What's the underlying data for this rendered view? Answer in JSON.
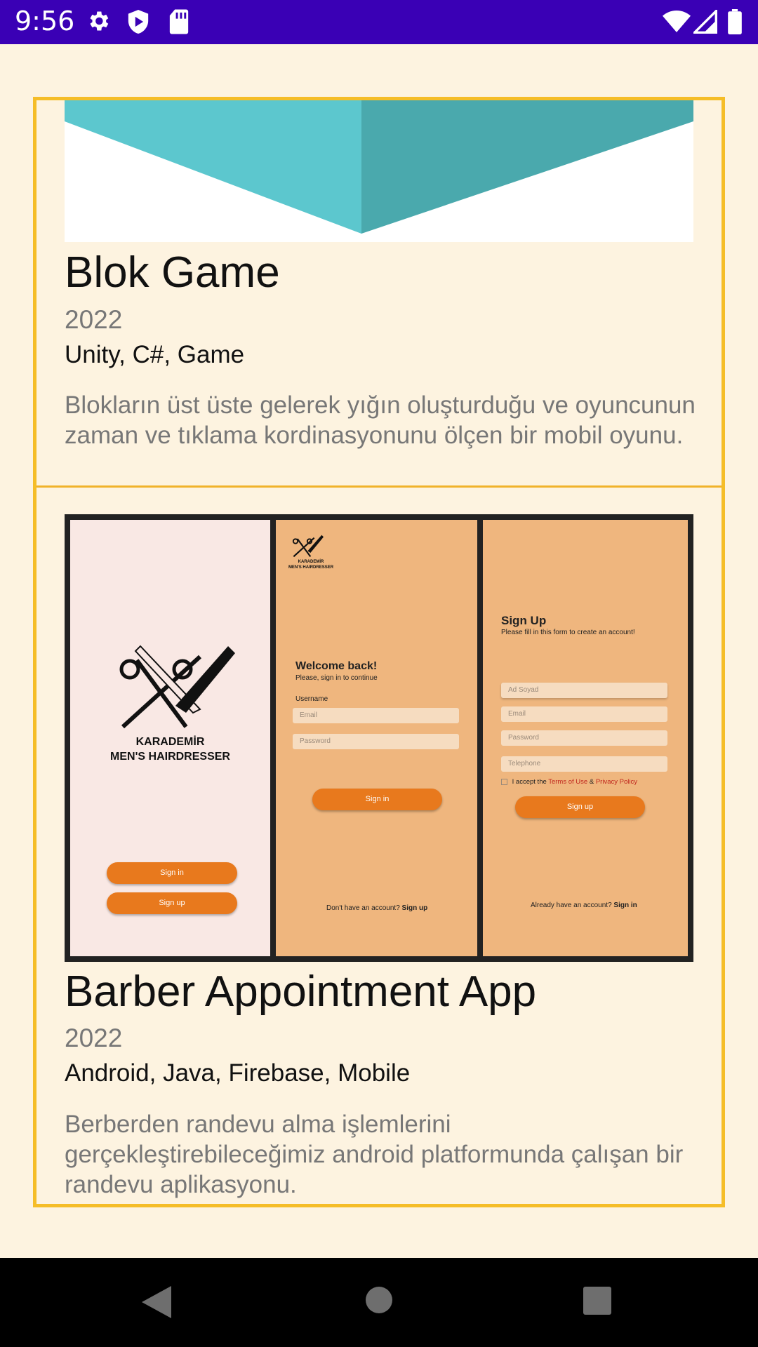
{
  "status_bar": {
    "time": "9:56",
    "icons": [
      "gear-icon",
      "play-shield-icon",
      "sd-card-icon",
      "wifi-icon",
      "signal-icon",
      "battery-icon"
    ]
  },
  "colors": {
    "status_bar": "#3a00b5",
    "background": "#fdf3e0",
    "card_border": "#f5bd28",
    "accent_orange": "#e8791d"
  },
  "projects": [
    {
      "title": "Blok Game",
      "year": "2022",
      "tags": "Unity, C#, Game",
      "description": "Blokların üst üste gelerek yığın oluşturduğu ve oyuncunun zaman ve tıklama kordinasyonunu ölçen bir mobil oyunu."
    },
    {
      "title": "Barber Appointment App",
      "year": "2022",
      "tags": "Android, Java, Firebase, Mobile",
      "description": "Berberden randevu alma işlemlerini gerçekleştirebileceğimiz android platformunda çalışan bir randevu aplikasyonu.",
      "screens": {
        "brand_line1": "KARADEMİR",
        "brand_line2": "MEN'S HAIRDRESSER",
        "sign_in": "Sign in",
        "sign_up": "Sign up",
        "welcome": "Welcome back!",
        "welcome_sub": "Please, sign in to continue",
        "username_label": "Username",
        "email_placeholder": "Email",
        "password_placeholder": "Password",
        "no_account": "Don't have an account?",
        "signup_title": "Sign Up",
        "signup_sub": "Please fill in this form to create an account!",
        "name_placeholder": "Ad Soyad",
        "telephone_placeholder": "Telephone",
        "accept_prefix": "I accept the",
        "terms": "Terms of Use",
        "amp": "&",
        "privacy": "Privacy Policy",
        "already": "Already have an account?"
      }
    }
  ],
  "nav_bar": {
    "icons": [
      "back-icon",
      "home-icon",
      "recents-icon"
    ]
  }
}
